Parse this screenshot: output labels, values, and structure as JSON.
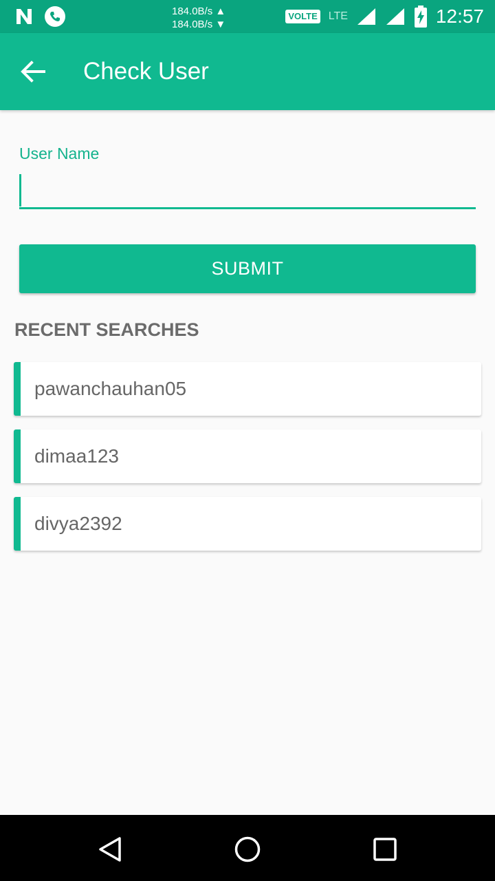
{
  "status_bar": {
    "speed_up": "184.0B/s ▲",
    "speed_down": "184.0B/s ▼",
    "volte": "VOLTE",
    "lte": "LTE",
    "time": "12:57",
    "left_icons": [
      "n-logo-icon",
      "phone-icon"
    ],
    "right_icons": [
      "signal-icon",
      "battery-charging-icon"
    ]
  },
  "app_bar": {
    "title": "Check User",
    "back_icon": "arrow-back-icon"
  },
  "form": {
    "label": "User Name",
    "input_value": "",
    "submit_label": "SUBMIT"
  },
  "recent": {
    "title": "RECENT SEARCHES",
    "items": [
      {
        "label": "pawanchauhan05"
      },
      {
        "label": "dimaa123"
      },
      {
        "label": "divya2392"
      }
    ]
  },
  "nav_bar": {
    "icons": [
      "back-triangle-icon",
      "home-circle-icon",
      "recents-square-icon"
    ]
  },
  "colors": {
    "primary": "#10b990",
    "primary_dark": "#0aa57f",
    "background": "#fafafa"
  }
}
